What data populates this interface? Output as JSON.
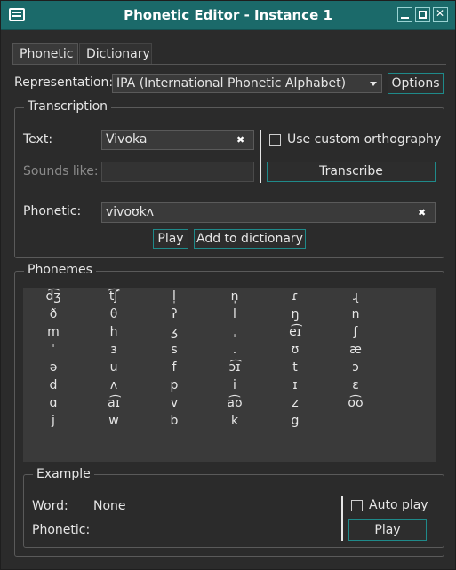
{
  "window": {
    "title": "Phonetic Editor - Instance 1"
  },
  "tabs": [
    {
      "label": "Phonetic"
    },
    {
      "label": "Dictionary"
    }
  ],
  "representation": {
    "label": "Representation:",
    "selected": "IPA (International Phonetic Alphabet)",
    "options_button": "Options"
  },
  "transcription": {
    "group_title": "Transcription",
    "text_label": "Text:",
    "text_value": "Vivoka",
    "custom_orthography_label": "Use custom orthography",
    "sounds_like_label": "Sounds like:",
    "sounds_like_value": "",
    "transcribe_button": "Transcribe",
    "phonetic_label": "Phonetic:",
    "phonetic_value": "vivoʊkʌ",
    "play_button": "Play",
    "add_button": "Add to dictionary"
  },
  "phonemes": {
    "group_title": "Phonemes",
    "rows": [
      [
        "d͡ʒ",
        "t͡ʃ",
        "l̩",
        "n̩",
        "ɾ",
        "ɻ"
      ],
      [
        "ð",
        "θ",
        "ʔ",
        "l",
        "ŋ",
        "n"
      ],
      [
        "m",
        "h",
        "ʒ",
        "ˌ",
        "e͡ɪ",
        "ʃ"
      ],
      [
        "ˈ",
        "ɜ",
        "s",
        ".",
        "ʊ",
        "æ"
      ],
      [
        "ə",
        "u",
        "f",
        "ɔ͡ɪ",
        "t",
        "ɔ"
      ],
      [
        "d",
        "ʌ",
        "p",
        "i",
        "ɪ",
        "ɛ"
      ],
      [
        "ɑ",
        "a͡ɪ",
        "v",
        "a͡ʊ",
        "z",
        "o͡ʊ"
      ],
      [
        "j",
        "w",
        "b",
        "k",
        "g",
        ""
      ]
    ]
  },
  "example": {
    "group_title": "Example",
    "word_label": "Word:",
    "word_value": "None",
    "phonetic_label": "Phonetic:",
    "phonetic_value": "",
    "auto_play_label": "Auto play",
    "play_button": "Play"
  }
}
